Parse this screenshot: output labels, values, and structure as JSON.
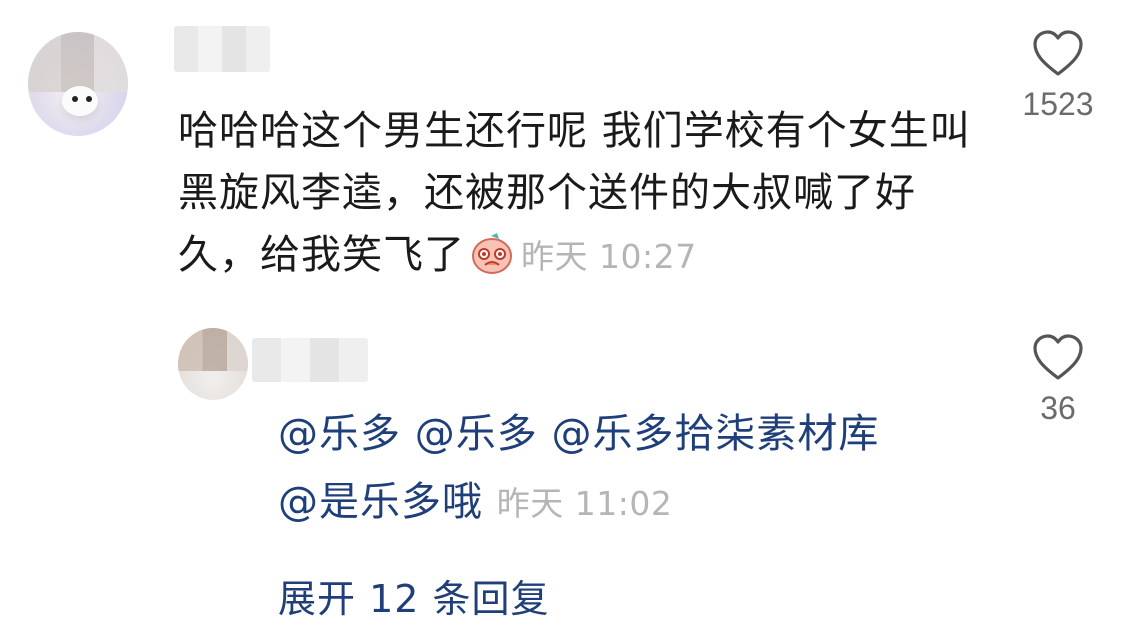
{
  "comment": {
    "text": "哈哈哈这个男生还行呢 我们学校有个女生叫黑旋风李逵，还被那个送件的大叔喊了好久，给我笑飞了",
    "sticker_icon": "blushing-emoji-sticker",
    "time": "昨天 10:27",
    "like_count": "1523"
  },
  "reply": {
    "mentions": [
      "@乐多",
      "@乐多",
      "@乐多拾柒素材库",
      "@是乐多哦"
    ],
    "time": "昨天 11:02",
    "like_count": "36"
  },
  "expand_label": "展开 12 条回复",
  "colors": {
    "link": "#1f3f7a",
    "timestamp": "#b5b5b5",
    "text": "#1a1a1a",
    "like_count": "#6b6b6b"
  }
}
